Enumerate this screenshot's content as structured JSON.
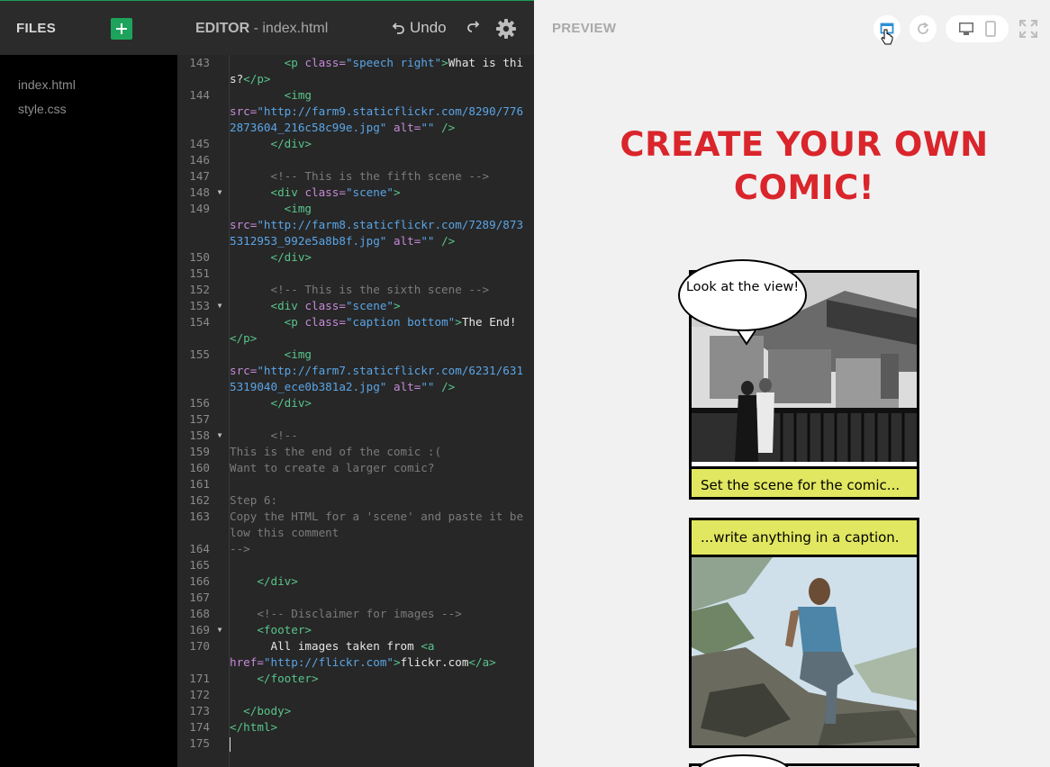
{
  "files": {
    "title": "FILES",
    "items": [
      "index.html",
      "style.css"
    ]
  },
  "editor": {
    "title": "EDITOR",
    "filename": " - index.html",
    "undo_label": "Undo"
  },
  "preview": {
    "title": "PREVIEW",
    "comic_title_line1": "CREATE YOUR OWN",
    "comic_title_line2": "COMIC!",
    "panel1_bubble": "Look at the view!",
    "panel1_caption": "Set the scene for the comic...",
    "panel2_caption": "...write anything in a caption."
  },
  "code_lines": [
    {
      "n": "143",
      "html": "        <span class=\"tag\">&lt;p</span> <span class=\"attr\">class=</span><span class=\"str\">\"speech right\"</span><span class=\"tag\">&gt;</span><span class=\"plain\">What is this?</span><span class=\"tag\">&lt;/p&gt;</span>"
    },
    {
      "n": "144",
      "html": "        <span class=\"tag\">&lt;img</span>\n<span class=\"attr\">src=</span><span class=\"str\">\"http://farm9.staticflickr.com/8290/7762873604_216c58c99e.jpg\"</span> <span class=\"attr\">alt=</span><span class=\"str\">\"\"</span> <span class=\"tag\">/&gt;</span>"
    },
    {
      "n": "145",
      "html": "      <span class=\"tag\">&lt;/div&gt;</span>"
    },
    {
      "n": "146",
      "html": ""
    },
    {
      "n": "147",
      "html": "      <span class=\"comment\">&lt;!-- This is the fifth scene --&gt;</span>"
    },
    {
      "n": "148",
      "fold": true,
      "html": "      <span class=\"tag\">&lt;div</span> <span class=\"attr\">class=</span><span class=\"str\">\"scene\"</span><span class=\"tag\">&gt;</span>"
    },
    {
      "n": "149",
      "html": "        <span class=\"tag\">&lt;img</span>\n<span class=\"attr\">src=</span><span class=\"str\">\"http://farm8.staticflickr.com/7289/8735312953_992e5a8b8f.jpg\"</span> <span class=\"attr\">alt=</span><span class=\"str\">\"\"</span> <span class=\"tag\">/&gt;</span>"
    },
    {
      "n": "150",
      "html": "      <span class=\"tag\">&lt;/div&gt;</span>"
    },
    {
      "n": "151",
      "html": ""
    },
    {
      "n": "152",
      "html": "      <span class=\"comment\">&lt;!-- This is the sixth scene --&gt;</span>"
    },
    {
      "n": "153",
      "fold": true,
      "html": "      <span class=\"tag\">&lt;div</span> <span class=\"attr\">class=</span><span class=\"str\">\"scene\"</span><span class=\"tag\">&gt;</span>"
    },
    {
      "n": "154",
      "html": "        <span class=\"tag\">&lt;p</span> <span class=\"attr\">class=</span><span class=\"str\">\"caption bottom\"</span><span class=\"tag\">&gt;</span><span class=\"plain\">The End!</span><span class=\"tag\">&lt;/p&gt;</span>"
    },
    {
      "n": "155",
      "html": "        <span class=\"tag\">&lt;img</span>\n<span class=\"attr\">src=</span><span class=\"str\">\"http://farm7.staticflickr.com/6231/6315319040_ece0b381a2.jpg\"</span> <span class=\"attr\">alt=</span><span class=\"str\">\"\"</span> <span class=\"tag\">/&gt;</span>"
    },
    {
      "n": "156",
      "html": "      <span class=\"tag\">&lt;/div&gt;</span>"
    },
    {
      "n": "157",
      "html": ""
    },
    {
      "n": "158",
      "fold": true,
      "html": "      <span class=\"comment\">&lt;!--</span>"
    },
    {
      "n": "159",
      "html": "<span class=\"comment\">This is the end of the comic :(</span>"
    },
    {
      "n": "160",
      "html": "<span class=\"comment\">Want to create a larger comic?</span>"
    },
    {
      "n": "161",
      "html": ""
    },
    {
      "n": "162",
      "html": "<span class=\"comment\">Step 6:</span>"
    },
    {
      "n": "163",
      "html": "<span class=\"comment\">Copy the HTML for a 'scene' and paste it below this comment</span>"
    },
    {
      "n": "164",
      "html": "<span class=\"comment\">--&gt;</span>"
    },
    {
      "n": "165",
      "html": ""
    },
    {
      "n": "166",
      "html": "    <span class=\"tag\">&lt;/div&gt;</span>"
    },
    {
      "n": "167",
      "html": ""
    },
    {
      "n": "168",
      "html": "    <span class=\"comment\">&lt;!-- Disclaimer for images --&gt;</span>"
    },
    {
      "n": "169",
      "fold": true,
      "html": "    <span class=\"tag\">&lt;footer&gt;</span>"
    },
    {
      "n": "170",
      "html": "      <span class=\"plain\">All images taken from </span><span class=\"tag\">&lt;a</span>\n<span class=\"attr\">href=</span><span class=\"str\">\"http://flickr.com\"</span><span class=\"tag\">&gt;</span><span class=\"plain\">flickr.com</span><span class=\"tag\">&lt;/a&gt;</span>"
    },
    {
      "n": "171",
      "html": "    <span class=\"tag\">&lt;/footer&gt;</span>"
    },
    {
      "n": "172",
      "html": ""
    },
    {
      "n": "173",
      "html": "  <span class=\"tag\">&lt;/body&gt;</span>"
    },
    {
      "n": "174",
      "html": "<span class=\"tag\">&lt;/html&gt;</span>"
    },
    {
      "n": "175",
      "cursor": true,
      "html": ""
    }
  ]
}
